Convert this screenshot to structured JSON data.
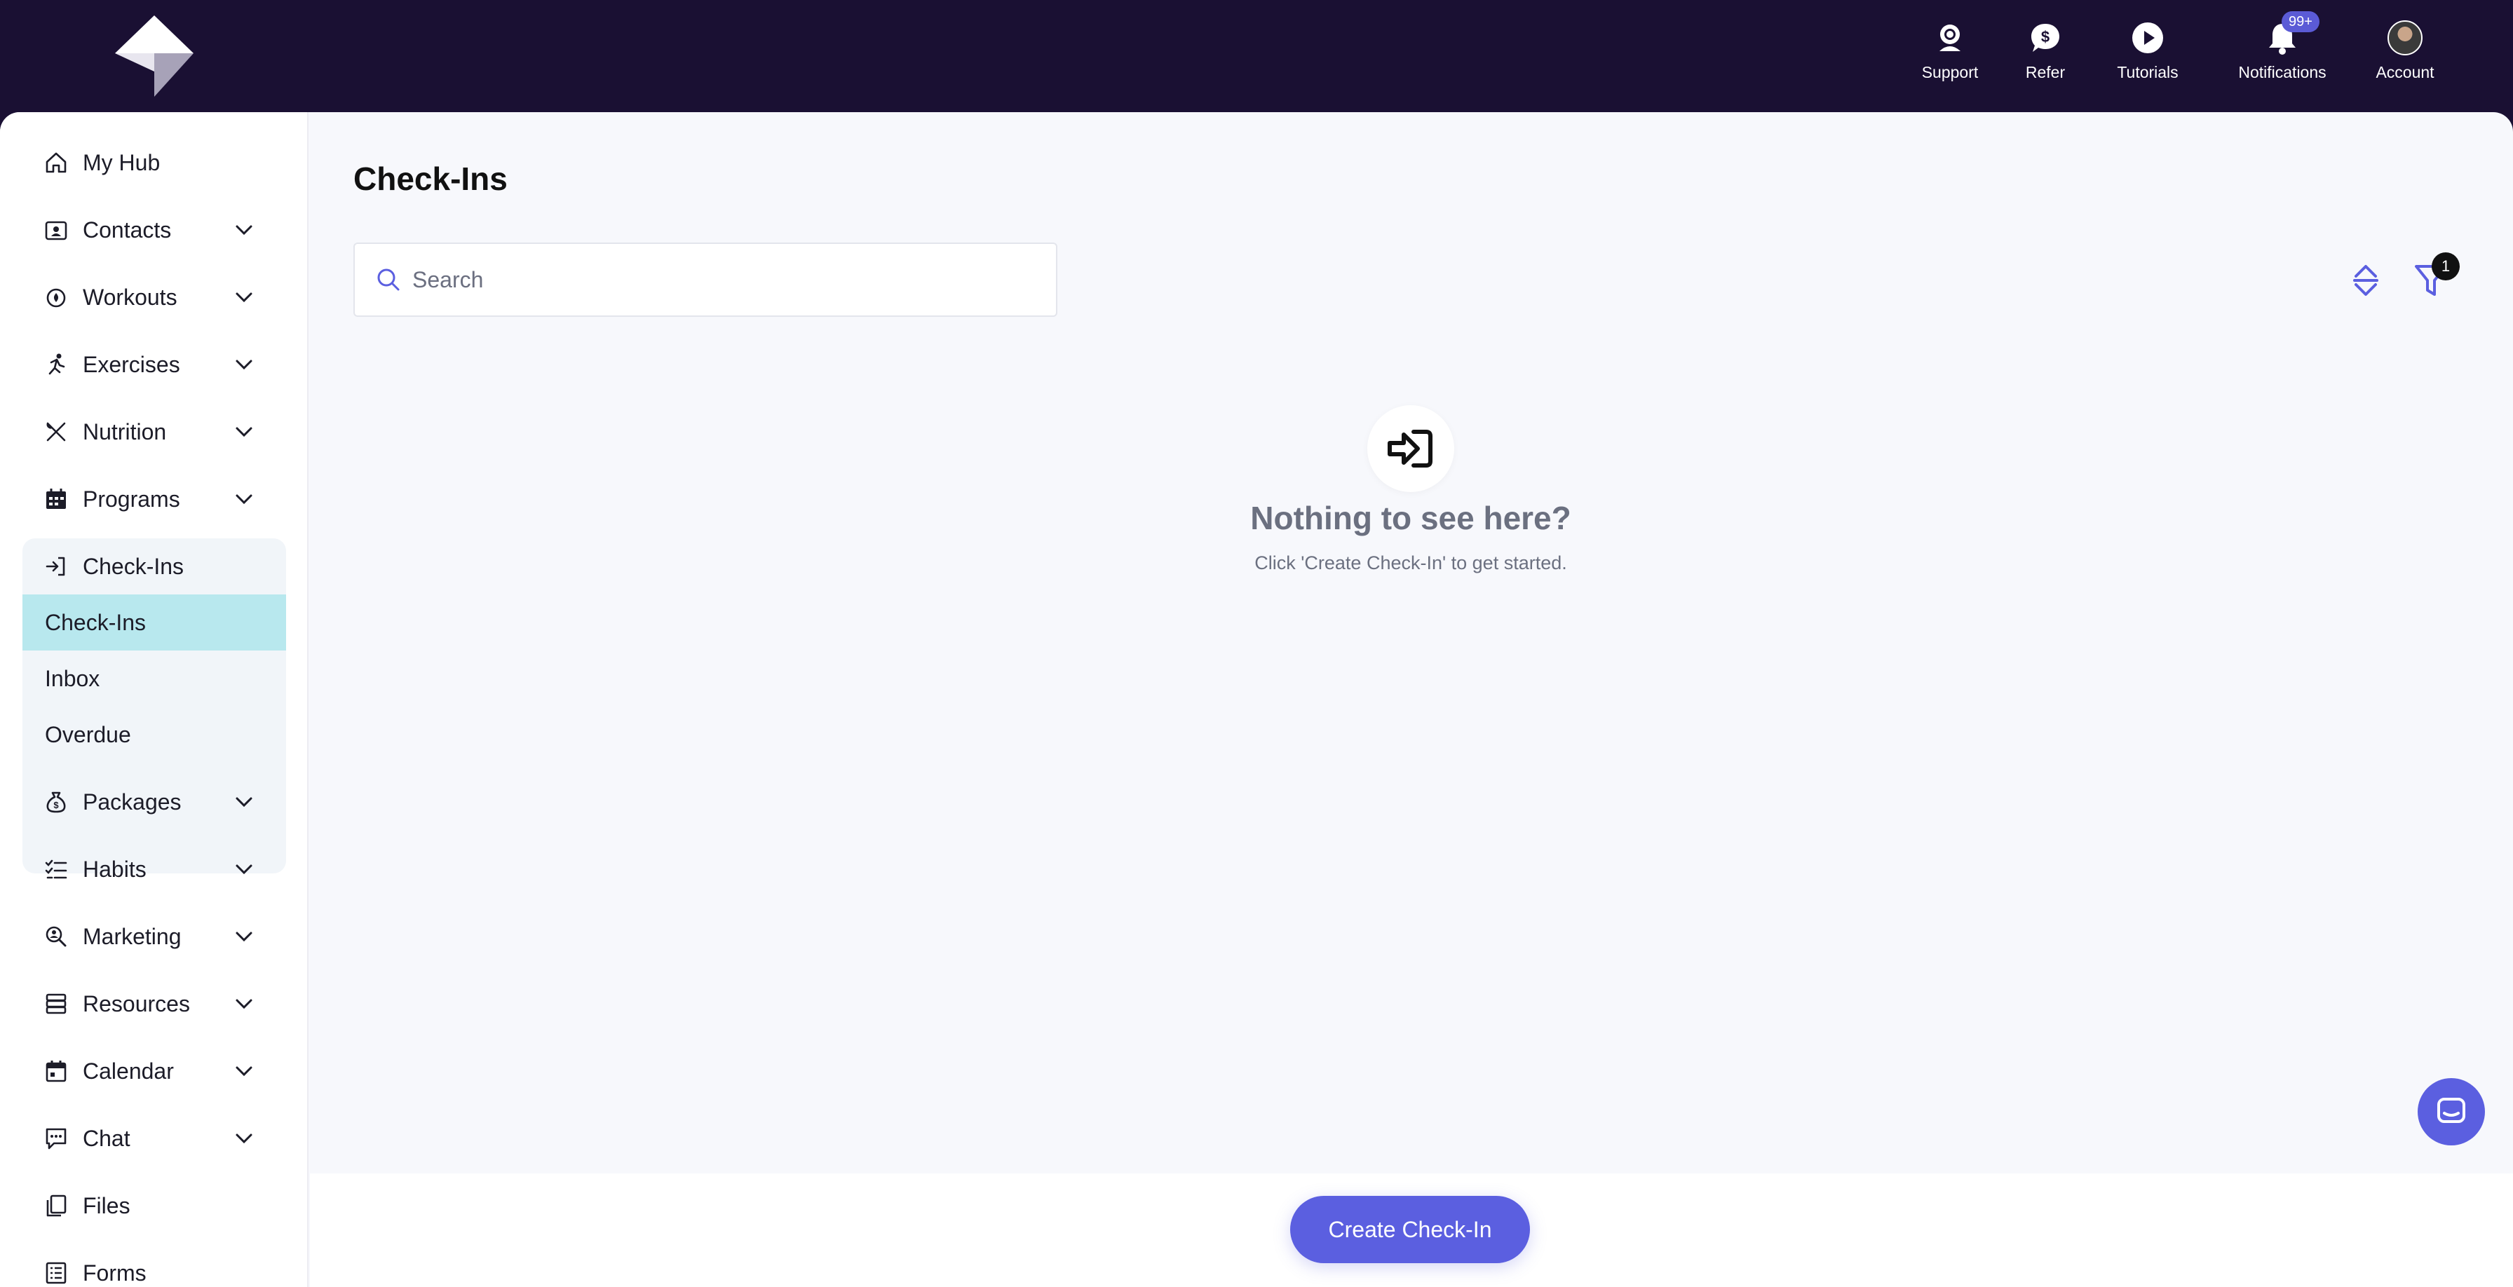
{
  "topbar": {
    "items": [
      {
        "label": "Support",
        "icon": "support-headset-icon"
      },
      {
        "label": "Refer",
        "icon": "dollar-chat-icon"
      },
      {
        "label": "Tutorials",
        "icon": "play-circle-icon"
      },
      {
        "label": "Notifications",
        "icon": "bell-icon",
        "badge": "99+"
      },
      {
        "label": "Account",
        "icon": "avatar"
      }
    ]
  },
  "sidebar": {
    "items": [
      {
        "label": "My Hub",
        "icon": "home-icon"
      },
      {
        "label": "Contacts",
        "icon": "contacts-icon"
      },
      {
        "label": "Workouts",
        "icon": "workouts-icon"
      },
      {
        "label": "Exercises",
        "icon": "running-icon"
      },
      {
        "label": "Nutrition",
        "icon": "utensils-icon"
      },
      {
        "label": "Programs",
        "icon": "calendar-grid-icon"
      },
      {
        "label": "Check-Ins",
        "icon": "sign-in-icon"
      },
      {
        "label": "Packages",
        "icon": "money-bag-icon"
      },
      {
        "label": "Habits",
        "icon": "checklist-icon"
      },
      {
        "label": "Marketing",
        "icon": "search-person-icon"
      },
      {
        "label": "Resources",
        "icon": "stack-icon"
      },
      {
        "label": "Calendar",
        "icon": "calendar-icon"
      },
      {
        "label": "Chat",
        "icon": "chat-icon"
      },
      {
        "label": "Files",
        "icon": "files-icon"
      },
      {
        "label": "Forms",
        "icon": "forms-icon"
      }
    ],
    "checkins_sub": [
      {
        "label": "Check-Ins",
        "active": true
      },
      {
        "label": "Inbox",
        "active": false
      },
      {
        "label": "Overdue",
        "active": false
      }
    ]
  },
  "main": {
    "title": "Check-Ins",
    "search": {
      "placeholder": "Search",
      "value": ""
    },
    "filter_count": "1",
    "empty": {
      "title": "Nothing to see here?",
      "subtitle": "Click 'Create Check-In' to get started."
    },
    "create_button": "Create Check-In"
  },
  "colors": {
    "topbar_bg": "#1a1033",
    "accent": "#5b5fe0",
    "active_sub_bg": "#b8e8ee"
  }
}
